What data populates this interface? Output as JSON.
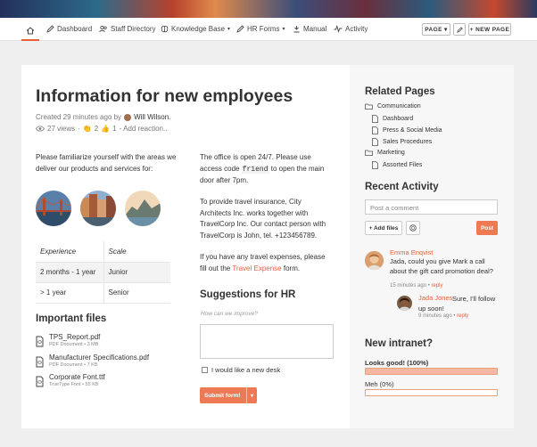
{
  "nav": {
    "items": [
      {
        "label": "Dashboard",
        "icon": "pencil-icon"
      },
      {
        "label": "Staff Directory",
        "icon": "users-icon"
      },
      {
        "label": "Knowledge Base",
        "icon": "brain-icon"
      },
      {
        "label": "HR Forms",
        "icon": "pencil-icon"
      },
      {
        "label": "Manual",
        "icon": "bookmark-icon"
      },
      {
        "label": "Activity",
        "icon": "pulse-icon"
      }
    ],
    "page_btn": "PAGE ▾",
    "new_page_btn": "+ NEW PAGE"
  },
  "page": {
    "title": "Information for new employees",
    "created": "Created 29 minutes ago by",
    "author": "Will Wilson.",
    "views": "27 views",
    "claps": "2",
    "thumbs": "1",
    "add_reaction": "- Add reaction..",
    "intro": "Please familiarize yourself with the areas we deliver our products and services for:",
    "office_1": "The office is open 24/7. Please use access code",
    "office_code": "fr1end",
    "office_2": "to open the main door after 7pm.",
    "insurance": "To provide travel insurance, City Architects Inc. works together with TravelCorp Inc. Our contact person with TravelCorp is John, tel. +123456789.",
    "expenses_1": "If you have any travel expenses, please fill out the",
    "expenses_link": "Travel Expense",
    "expenses_2": "form.",
    "table": {
      "headers": [
        "Experience",
        "Scale"
      ],
      "rows": [
        [
          "2 months - 1 year",
          "Junior"
        ],
        [
          "> 1 year",
          "Senior"
        ]
      ]
    },
    "files_title": "Important files",
    "files": [
      {
        "name": "TPS_Report.pdf",
        "info": "PDF Document • 3 MB"
      },
      {
        "name": "Manufacturer Specifications.pdf",
        "info": "PDF Document • 7 KB"
      },
      {
        "name": "Corporate Font.ttf",
        "info": "TrueType Font • 55 KB"
      }
    ],
    "suggestions_title": "Suggestions for HR",
    "suggestions_placeholder": "How can we improve?",
    "desk_label": "I would like a new desk",
    "submit_label": "Submit form!"
  },
  "sidebar": {
    "related_title": "Related Pages",
    "tree": [
      {
        "label": "Communication",
        "type": "folder"
      },
      {
        "label": "Dashboard",
        "type": "page"
      },
      {
        "label": "Press & Social Media",
        "type": "page"
      },
      {
        "label": "Sales Procedures",
        "type": "page"
      },
      {
        "label": "Marketing",
        "type": "folder"
      },
      {
        "label": "Assorted Files",
        "type": "page"
      }
    ],
    "activity_title": "Recent Activity",
    "comment_placeholder": "Post a comment",
    "add_files": "+ Add files",
    "post": "Post",
    "comments": [
      {
        "name": "Emma Enqvist",
        "text": "Jada, could you give Mark a call about the gift card promotion deal?",
        "time": "15 minutes ago",
        "sep": "•",
        "reply": "reply"
      },
      {
        "name": "Jada Jones",
        "text": "Sure, I'll follow up soon!",
        "time": "9 minutes ago",
        "sep": "•",
        "reply": "reply"
      }
    ],
    "poll_title": "New intranet?",
    "poll": [
      {
        "label": "Looks good! (100%)",
        "fraction": 1.0
      },
      {
        "label": "Meh (0%)",
        "fraction": 0.0
      }
    ]
  },
  "colors": {
    "accent": "#e8603a"
  }
}
